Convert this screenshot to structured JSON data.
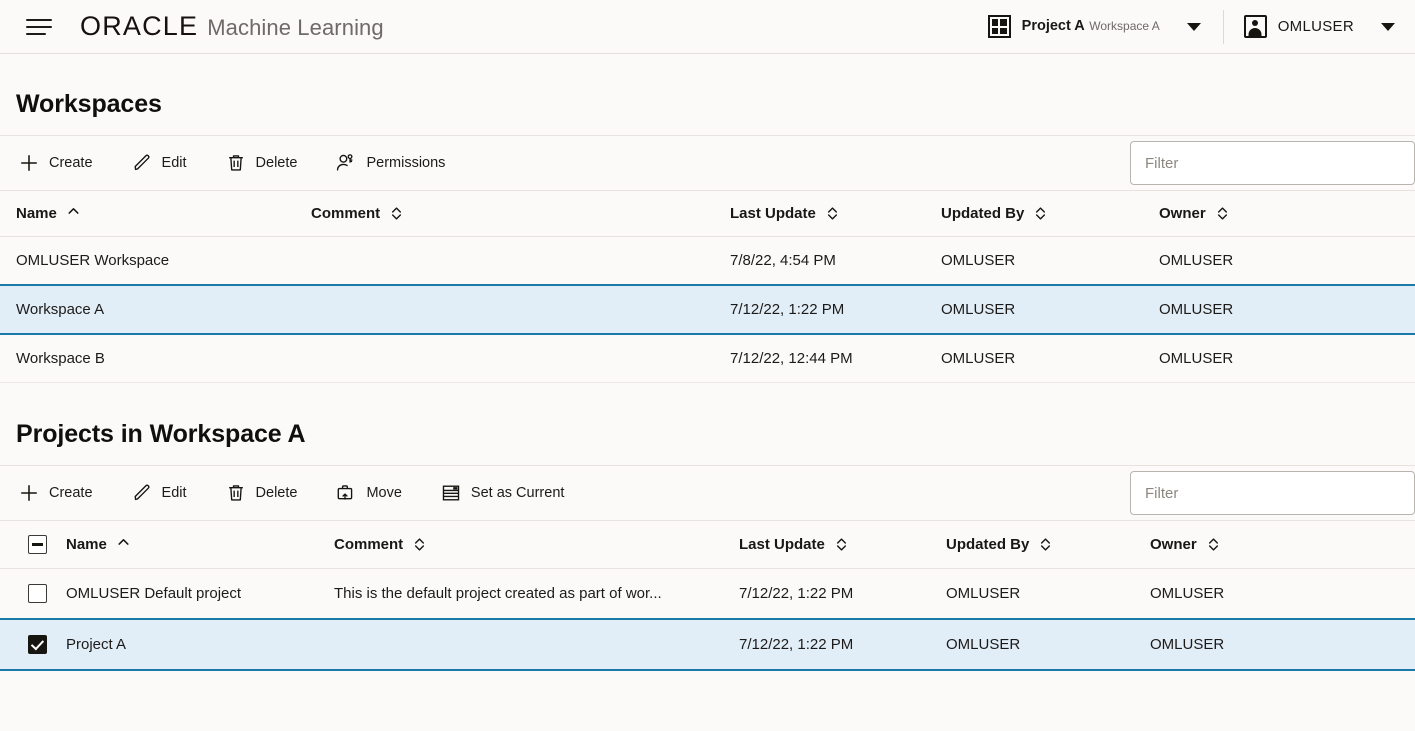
{
  "header": {
    "menu_icon": "hamburger-menu-icon",
    "brand_oracle": "ORACLE",
    "brand_product": "Machine Learning",
    "project_switcher": {
      "icon": "grid-icon",
      "project": "Project A",
      "workspace": "Workspace A",
      "caret": "chevron-down-icon"
    },
    "user_menu": {
      "icon": "user-avatar-icon",
      "name": "OMLUSER",
      "caret": "chevron-down-icon"
    }
  },
  "workspaces": {
    "title": "Workspaces",
    "toolbar": [
      {
        "label": "Create",
        "icon": "plus-icon"
      },
      {
        "label": "Edit",
        "icon": "pencil-icon"
      },
      {
        "label": "Delete",
        "icon": "trash-icon"
      },
      {
        "label": "Permissions",
        "icon": "user-key-icon"
      }
    ],
    "filter": {
      "value": "",
      "placeholder": "Filter"
    },
    "columns": [
      {
        "label": "Name",
        "sort": "asc"
      },
      {
        "label": "Comment",
        "sort": "none"
      },
      {
        "label": "Last Update",
        "sort": "none"
      },
      {
        "label": "Updated By",
        "sort": "none"
      },
      {
        "label": "Owner",
        "sort": "none"
      }
    ],
    "rows": [
      {
        "name": "OMLUSER Workspace",
        "comment": "",
        "last_update": "7/8/22, 4:54 PM",
        "updated_by": "OMLUSER",
        "owner": "OMLUSER",
        "selected": false
      },
      {
        "name": "Workspace A",
        "comment": "",
        "last_update": "7/12/22, 1:22 PM",
        "updated_by": "OMLUSER",
        "owner": "OMLUSER",
        "selected": true
      },
      {
        "name": "Workspace B",
        "comment": "",
        "last_update": "7/12/22, 12:44 PM",
        "updated_by": "OMLUSER",
        "owner": "OMLUSER",
        "selected": false
      }
    ]
  },
  "projects": {
    "title": "Projects in Workspace A",
    "toolbar": [
      {
        "label": "Create",
        "icon": "plus-icon"
      },
      {
        "label": "Edit",
        "icon": "pencil-icon"
      },
      {
        "label": "Delete",
        "icon": "trash-icon"
      },
      {
        "label": "Move",
        "icon": "briefcase-move-icon"
      },
      {
        "label": "Set as Current",
        "icon": "list-document-icon"
      }
    ],
    "filter": {
      "value": "",
      "placeholder": "Filter"
    },
    "select_all_state": "indeterminate",
    "columns": [
      {
        "label": "Name",
        "sort": "asc"
      },
      {
        "label": "Comment",
        "sort": "none"
      },
      {
        "label": "Last Update",
        "sort": "none"
      },
      {
        "label": "Updated By",
        "sort": "none"
      },
      {
        "label": "Owner",
        "sort": "none"
      }
    ],
    "rows": [
      {
        "checked": false,
        "name": "OMLUSER Default project",
        "comment": "This is the default project created as part of wor...",
        "last_update": "7/12/22, 1:22 PM",
        "updated_by": "OMLUSER",
        "owner": "OMLUSER",
        "selected": false
      },
      {
        "checked": true,
        "name": "Project A",
        "comment": "",
        "last_update": "7/12/22, 1:22 PM",
        "updated_by": "OMLUSER",
        "owner": "OMLUSER",
        "selected": true
      }
    ]
  },
  "colors": {
    "page_bg": "#fbfaf9",
    "selected_row_bg": "#e2eef7",
    "selected_row_border": "#1a7ba8",
    "text": "#1d1b19",
    "muted_text": "#6e6a66"
  }
}
